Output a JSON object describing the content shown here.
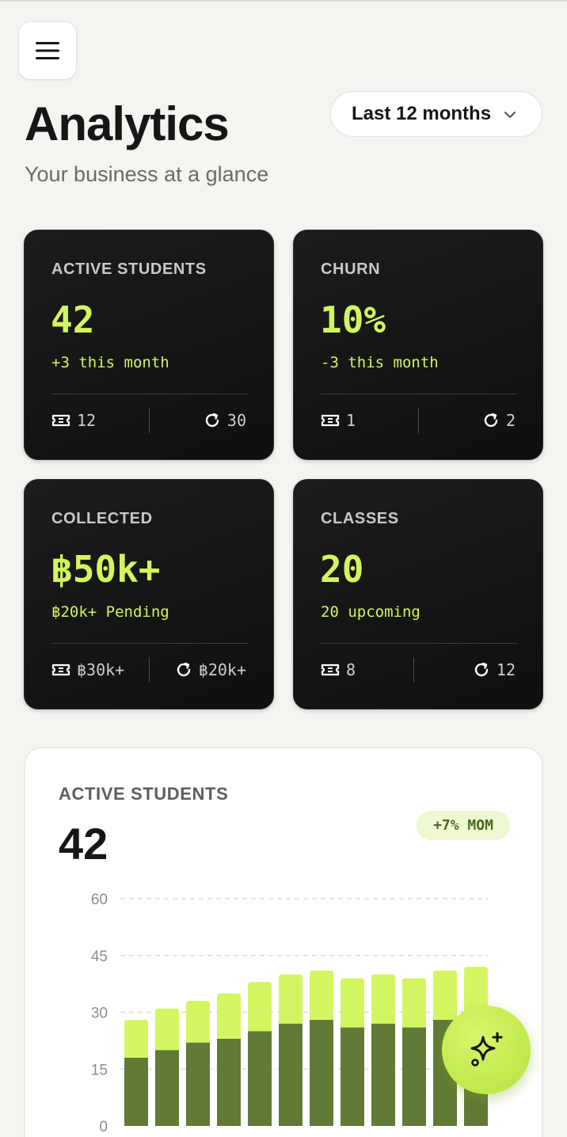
{
  "header": {
    "title": "Analytics",
    "subtitle": "Your business at a glance",
    "range": "Last 12 months"
  },
  "cards": [
    {
      "label": "ACTIVE STUDENTS",
      "value": "42",
      "delta": "+3 this month",
      "left": "12",
      "right": "30"
    },
    {
      "label": "CHURN",
      "value": "10%",
      "delta": "-3 this month",
      "left": "1",
      "right": "2"
    },
    {
      "label": "COLLECTED",
      "value": "฿50k+",
      "delta": "฿20k+ Pending",
      "left": "฿30k+",
      "right": "฿20k+"
    },
    {
      "label": "CLASSES",
      "value": "20",
      "delta": "20 upcoming",
      "left": "8",
      "right": "12"
    }
  ],
  "chart": {
    "label": "ACTIVE STUDENTS",
    "value": "42",
    "badge": "+7% MOM"
  },
  "colors": {
    "accent": "#d2f55f",
    "bar_dark": "#617a35",
    "bar_light": "#d4f562",
    "card_dark": "#141414"
  },
  "icons": {
    "menu": "menu-icon",
    "chevron": "chevron-down-icon",
    "ticket": "ticket-icon",
    "refresh": "refresh-icon",
    "sparkle": "sparkle-icon"
  },
  "chart_data": {
    "type": "bar",
    "stacked": true,
    "categories": [
      "",
      "",
      "",
      "",
      "",
      "",
      "",
      "",
      "",
      "",
      "",
      ""
    ],
    "series": [
      {
        "values": [
          18,
          20,
          22,
          23,
          25,
          27,
          28,
          26,
          27,
          26,
          28,
          29
        ]
      },
      {
        "values": [
          10,
          11,
          11,
          12,
          13,
          13,
          13,
          13,
          13,
          13,
          13,
          13
        ]
      }
    ],
    "yticks": [
      "0",
      "15",
      "30",
      "45",
      "60"
    ],
    "ylim": [
      0,
      60
    ],
    "grid": true
  }
}
